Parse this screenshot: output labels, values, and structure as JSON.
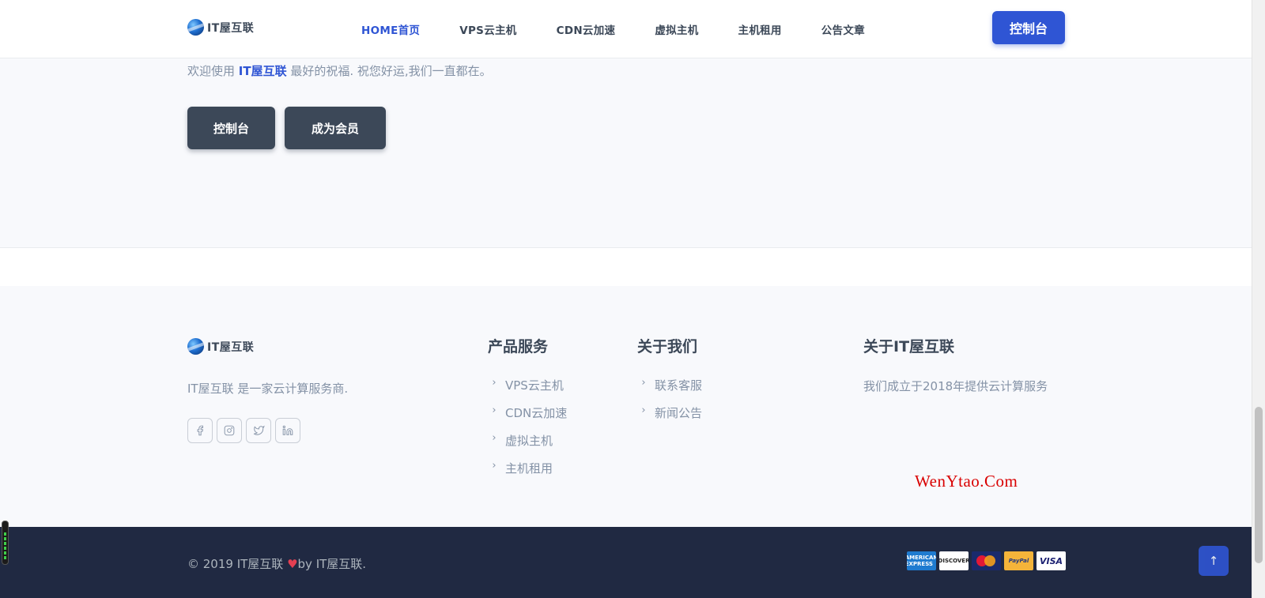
{
  "brand": {
    "logo_text": "IT屋互联",
    "primary_color": "#2f55d4",
    "dark_color": "#3c4858",
    "footer_bg": "#202942"
  },
  "nav": {
    "items": [
      {
        "label": "HOME首页",
        "active": true
      },
      {
        "label": "VPS云主机",
        "active": false
      },
      {
        "label": "CDN云加速",
        "active": false
      },
      {
        "label": "虚拟主机",
        "active": false
      },
      {
        "label": "主机租用",
        "active": false
      },
      {
        "label": "公告文章",
        "active": false
      }
    ],
    "cta_label": "控制台"
  },
  "hero": {
    "welcome_prefix": "欢迎使用 ",
    "welcome_brand": "IT屋互联",
    "welcome_suffix": " 最好的祝福. 祝您好运,我们一直都在。",
    "buttons": [
      {
        "label": "控制台"
      },
      {
        "label": "成为会员"
      }
    ]
  },
  "footer": {
    "logo_text": "IT屋互联",
    "description": "IT屋互联 是一家云计算服务商.",
    "social": [
      "facebook-icon",
      "instagram-icon",
      "twitter-icon",
      "linkedin-icon"
    ],
    "columns": [
      {
        "title": "产品服务",
        "links": [
          "VPS云主机",
          "CDN云加速",
          "虚拟主机",
          "主机租用"
        ]
      },
      {
        "title": "关于我们",
        "links": [
          "联系客服",
          "新闻公告"
        ]
      }
    ],
    "about": {
      "title": "关于IT屋互联",
      "text": "我们成立于2018年提供云计算服务"
    },
    "watermark": "WenYtao.Com"
  },
  "bottom": {
    "copyright_prefix": "© 2019 IT屋互联 ",
    "copyright_suffix": "by IT屋互联.",
    "payments": [
      {
        "name": "amex-card-icon",
        "label": "AMERICAN EXPRESS"
      },
      {
        "name": "discover-card-icon",
        "label": "DISCOVER"
      },
      {
        "name": "mastercard-card-icon",
        "label": ""
      },
      {
        "name": "paypal-card-icon",
        "label": "PayPal"
      },
      {
        "name": "visa-card-icon",
        "label": "VISA"
      }
    ]
  }
}
